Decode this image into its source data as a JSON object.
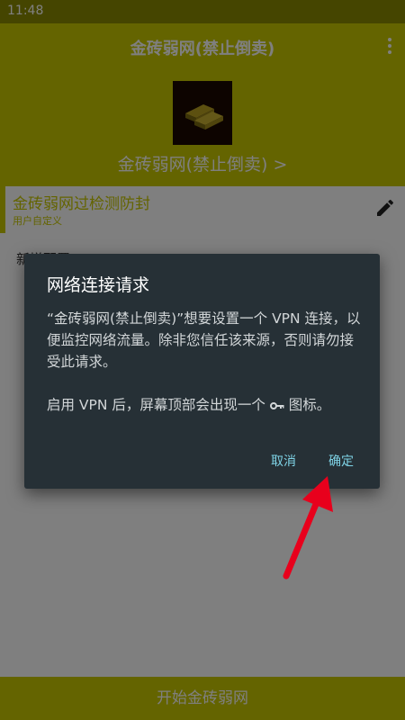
{
  "status_bar": {
    "time": "11:48"
  },
  "header": {
    "title": "金砖弱网(禁止倒卖)",
    "app_name": "金砖弱网(禁止倒卖) >"
  },
  "profile": {
    "name": "金砖弱网过检测防封",
    "subtitle": "用户自定义"
  },
  "list": {
    "item_label": "新增配置"
  },
  "bottom": {
    "start_label": "开始金砖弱网"
  },
  "dialog": {
    "title": "网络连接请求",
    "body_1": "“金砖弱网(禁止倒卖)”想要设置一个 VPN 连接，以便监控网络流量。除非您信任该来源，否则请勿接受此请求。",
    "body_2_before": "启用 VPN 后，屏幕顶部会出现一个",
    "body_2_after": "图标。",
    "cancel_label": "取消",
    "ok_label": "确定"
  },
  "colors": {
    "accent": "#c8c800",
    "dialog_bg": "#263036",
    "dialog_button": "#7fd3e6",
    "arrow": "#e8001c"
  }
}
